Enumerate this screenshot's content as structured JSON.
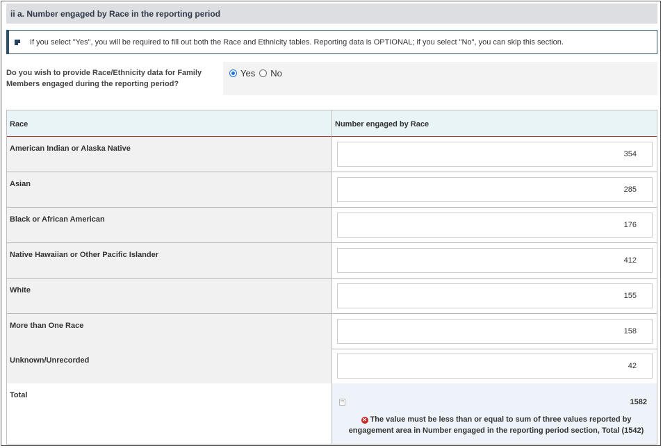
{
  "section": {
    "title": "ii a. Number engaged by Race in the reporting period"
  },
  "info": {
    "message": "If you select \"Yes\", you will be required to fill out both the Race and Ethnicity tables. Reporting data is OPTIONAL; if you select \"No\", you can skip this section."
  },
  "question": {
    "text": "Do you wish to provide Race/Ethnicity data for Family Members engaged during the reporting period?",
    "options": [
      {
        "label": "Yes",
        "selected": true
      },
      {
        "label": "No",
        "selected": false
      }
    ]
  },
  "table": {
    "headers": [
      "Race",
      "Number engaged by Race"
    ],
    "rows": [
      {
        "label": "American Indian or Alaska Native",
        "value": "354"
      },
      {
        "label": "Asian",
        "value": "285"
      },
      {
        "label": "Black or African American",
        "value": "176"
      },
      {
        "label": "Native Hawaiian or Other Pacific Islander",
        "value": "412"
      },
      {
        "label": "White",
        "value": "155"
      },
      {
        "label": "More than One Race",
        "value": "158"
      },
      {
        "label": "Unknown/Unrecorded",
        "value": "42"
      }
    ],
    "total": {
      "label": "Total",
      "value": "1582",
      "error": "The value must be less than or equal to sum of three values reported by engagement area in Number engaged in the reporting period section, Total (1542)"
    }
  },
  "icons": {
    "info": "info-icon",
    "calculator": "calculator-icon",
    "error": "error-circle-icon"
  },
  "colors": {
    "accent": "#1a73e8",
    "header_underline": "#b0322a",
    "error": "#c62828"
  }
}
